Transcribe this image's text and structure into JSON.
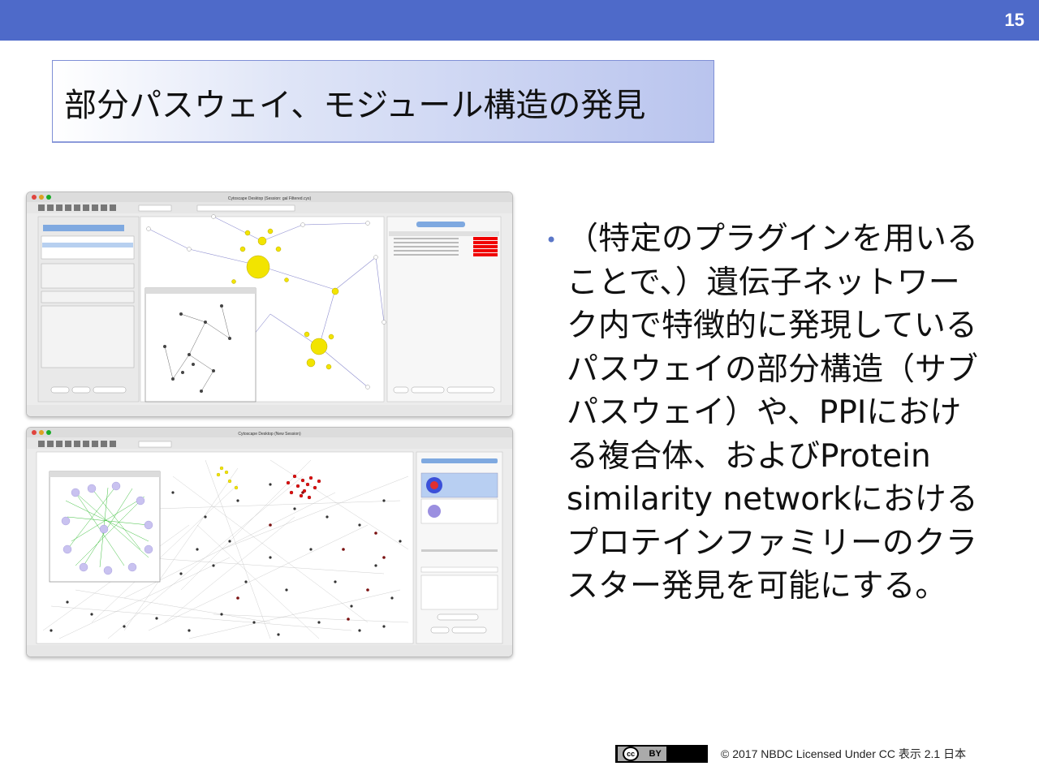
{
  "header": {
    "page_number": "15",
    "color": "#4e6ac9"
  },
  "title": "部分パスウェイ、モジュール構造の発見",
  "bullet": {
    "lines": [
      "（特定のプラグインを用いる",
      "ことで、）遺伝子ネットワー",
      "ク内で特徴的に発現している",
      "パスウェイの部分構造（サブ",
      "パスウェイ）や、PPIにおけ",
      "る複合体、およびProtein",
      "similarity networkにおける",
      "プロテインファミリーのクラ",
      "スター発見を可能にする。"
    ]
  },
  "screenshot_1": {
    "window_title": "Cytoscape Desktop (Session: gal Filtered.cys)"
  },
  "screenshot_2": {
    "window_title": "Cytoscape Desktop (New Session)"
  },
  "footer": {
    "license_badge": {
      "cc": "cc",
      "by": "BY"
    },
    "text": "© 2017 NBDC Licensed Under CC 表示 2.1 日本"
  }
}
